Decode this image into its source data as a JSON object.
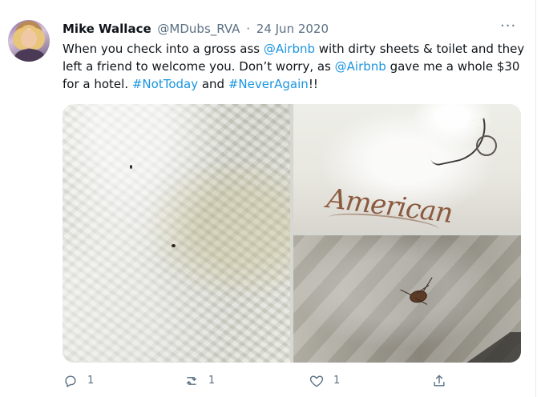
{
  "tweet": {
    "display_name": "Mike Wallace",
    "handle": "@MDubs_RVA",
    "separator": "·",
    "date": "24 Jun 2020",
    "text_parts": [
      "When you check into a gross ass ",
      "@Airbnb",
      " with dirty sheets & toilet and they left a friend to welcome you. Don’t worry, as ",
      "@Airbnb",
      " gave me a whole $30 for a hotel. ",
      "#NotToday",
      " and ",
      "#NeverAgain",
      "!!"
    ],
    "more_label": "···"
  },
  "media": {
    "photo_text": "American",
    "photos": [
      {
        "name": "dirty-sheet-photo"
      },
      {
        "name": "toilet-seat-photo"
      },
      {
        "name": "cockroach-floor-photo"
      }
    ]
  },
  "actions": {
    "reply_count": "1",
    "retweet_count": "1",
    "like_count": "1"
  },
  "icons": {
    "more": "more-horizontal-icon",
    "reply": "reply-icon",
    "retweet": "retweet-icon",
    "like": "like-icon",
    "share": "share-icon"
  },
  "colors": {
    "link": "#1b95e0",
    "secondary_text": "#5b7083",
    "primary_text": "#0f1419",
    "border": "#e6ecf0"
  }
}
